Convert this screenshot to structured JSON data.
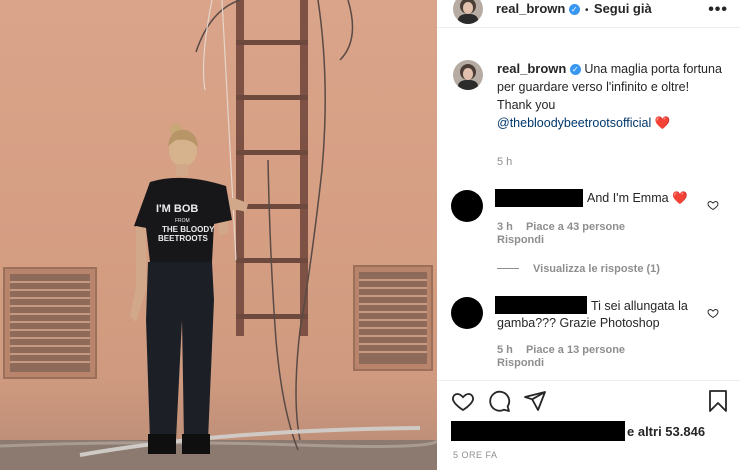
{
  "post": {
    "photo_alt": "photo",
    "shirt_text": [
      "I'M BOB",
      "FROM",
      "THE BLOODY",
      "BEETROOTS"
    ]
  },
  "header": {
    "username": "real_brown",
    "separator": "•",
    "follow_label": "Segui già",
    "more_label": "•••"
  },
  "caption": {
    "username": "real_brown",
    "text": "Una maglia porta fortuna per guardare verso l'infinito e oltre!",
    "thanks": "Thank you",
    "mention": "@thebloodybeetrootsofficial",
    "emoji": "❤️",
    "time": "5 h"
  },
  "comments": [
    {
      "text": "And I'm Emma",
      "emoji": "❤️",
      "time": "3 h",
      "likes": "Piace a 43 persone",
      "reply": "Rispondi"
    },
    {
      "text": "Ti sei allungata la gamba??? Grazie Photoshop",
      "time": "5 h",
      "likes": "Piace a 13 persone",
      "reply": "Rispondi"
    }
  ],
  "view_replies": "Visualizza le risposte (1)",
  "footer": {
    "likes_text": "e altri 53.846",
    "ago": "5 ORE FA"
  },
  "icons": {
    "verified": "verified-badge-icon",
    "like": "heart-icon",
    "comment": "comment-icon",
    "share": "share-icon",
    "save": "bookmark-icon"
  },
  "colors": {
    "wall": "#d69f84",
    "verified": "#3897f0",
    "mention": "#00376b",
    "heart": "#ed4956",
    "muted": "#8e8e8e"
  }
}
